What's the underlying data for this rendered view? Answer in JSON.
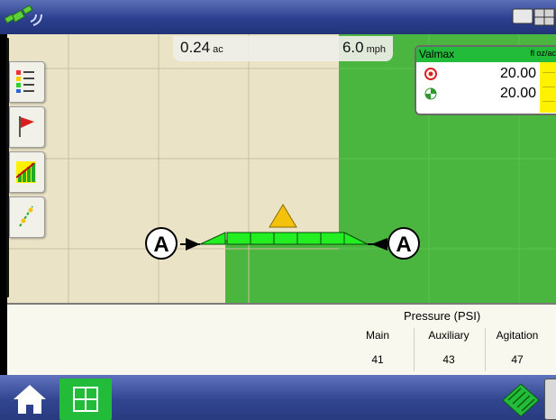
{
  "colors": {
    "topbar": "#2c3f8e",
    "coverage": "#4ab63f",
    "field": "#ebe3c6",
    "active_section": "#22ee22",
    "accent_green": "#22bb3a",
    "rate_bar": "#fff200",
    "warning_triangle": "#f4c20d"
  },
  "icons": {
    "gps": "gps-satellite-icon",
    "screen": "display-config-icon",
    "home": "home-icon",
    "map": "map-grid-icon",
    "field": "field-operation-icon"
  },
  "map": {
    "area_value": "0.24",
    "area_unit": "ac",
    "speed_value": "6.0",
    "speed_unit": "mph",
    "boom_left_label": "A",
    "boom_right_label": "A"
  },
  "product": {
    "name": "Valmax",
    "unit": "fl oz/ac",
    "target_rate": "20.00",
    "actual_rate": "20.00"
  },
  "pressure": {
    "title": "Pressure (PSI)",
    "columns": [
      {
        "label": "Main",
        "value": "41"
      },
      {
        "label": "Auxiliary",
        "value": "43"
      },
      {
        "label": "Agitation",
        "value": "47"
      }
    ]
  }
}
